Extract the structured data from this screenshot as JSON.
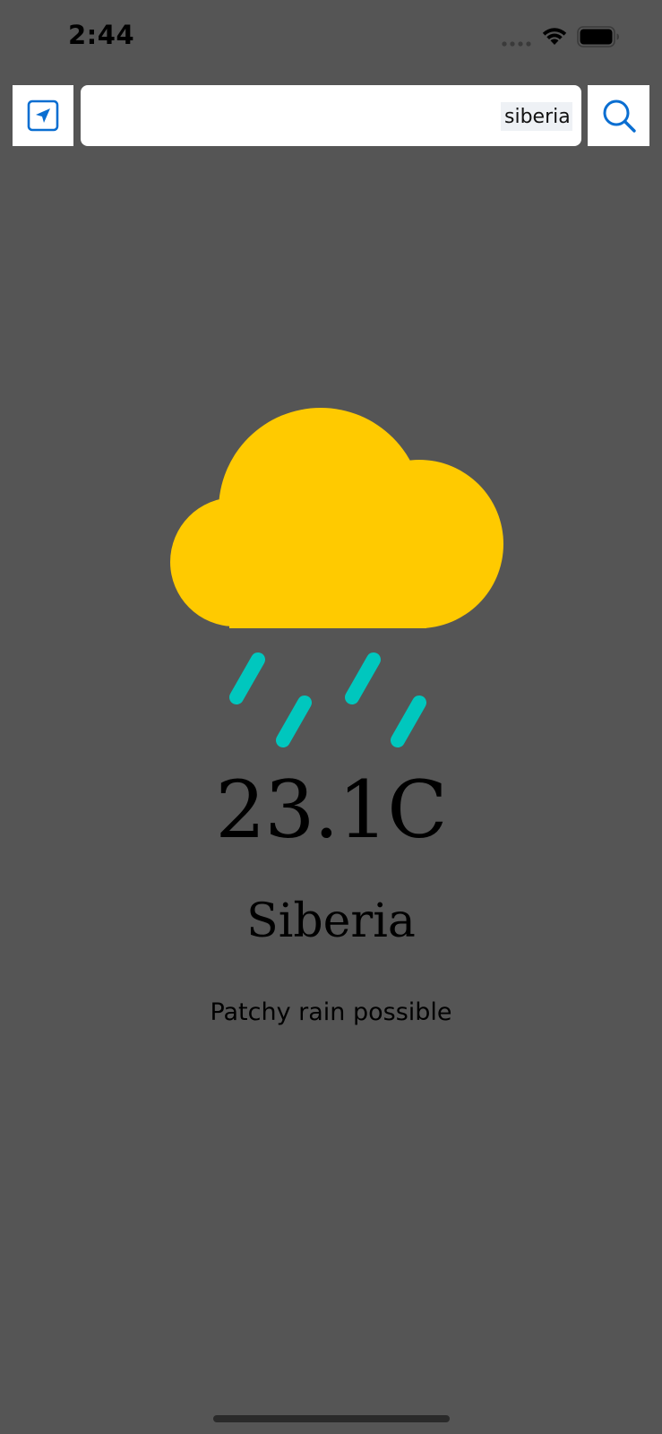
{
  "status_bar": {
    "time": "2:44",
    "icons": [
      "signal-dots-icon",
      "wifi-icon",
      "battery-icon"
    ]
  },
  "search": {
    "value": "siberia",
    "placeholder": "",
    "location_icon": "location-arrow-icon",
    "search_icon": "magnifier-icon"
  },
  "weather": {
    "icon": "cloud-rain-icon",
    "temperature": "23.1C",
    "city": "Siberia",
    "condition": "Patchy rain possible"
  },
  "colors": {
    "background": "#555555",
    "cloud": "#FFCA00",
    "rain": "#00C7BE",
    "accent": "#0A6ED1"
  }
}
